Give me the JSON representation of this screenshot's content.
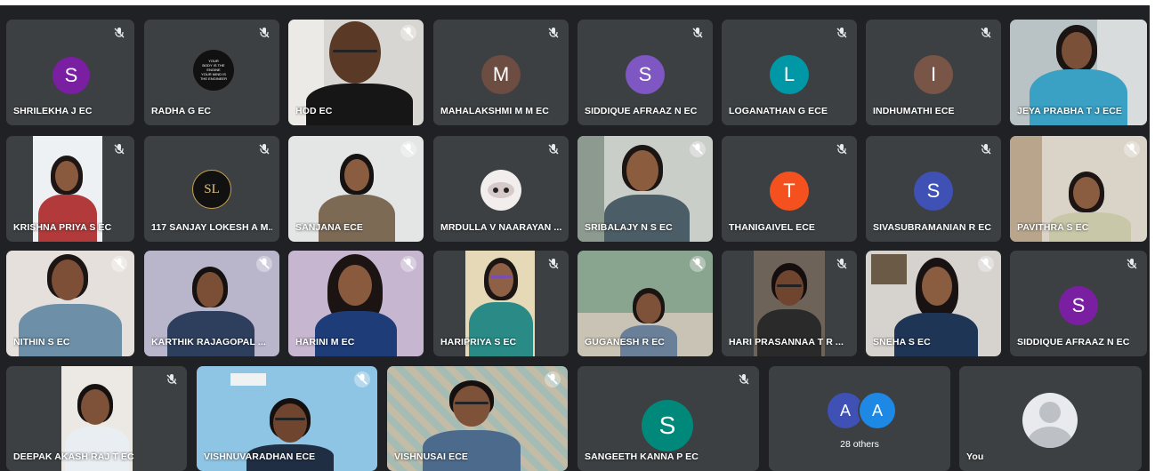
{
  "participants": [
    {
      "name": "SHRILEKHA J EC",
      "initial": "S",
      "avatar_color": "#7b1fa2"
    },
    {
      "name": "RADHA G EC",
      "logo_lines": [
        "YOUR",
        "BODY IS THE",
        "ENGINE",
        "YOUR MIND IS",
        "THE ENGINEER"
      ]
    },
    {
      "name": "HOD EC"
    },
    {
      "name": "MAHALAKSHMI M M EC",
      "initial": "M",
      "avatar_color": "#6d4c41"
    },
    {
      "name": "SIDDIQUE AFRAAZ N EC",
      "initial": "S",
      "avatar_color": "#7e57c2"
    },
    {
      "name": "LOGANATHAN G ECE",
      "initial": "L",
      "avatar_color": "#0097a7"
    },
    {
      "name": "INDHUMATHI ECE",
      "initial": "I",
      "avatar_color": "#795548"
    },
    {
      "name": "JEYA PRABHA T J ECE"
    },
    {
      "name": "KRISHNA PRIYA S EC"
    },
    {
      "name": "117 SANJAY LOKESH A M...",
      "logo_text": "SL"
    },
    {
      "name": "SANJANA ECE"
    },
    {
      "name": "MRDULLA V NAARAYAN ..."
    },
    {
      "name": "SRIBALAJY N S EC"
    },
    {
      "name": "THANIGAIVEL ECE",
      "initial": "T",
      "avatar_color": "#f4511e"
    },
    {
      "name": "SIVASUBRAMANIAN R EC",
      "initial": "S",
      "avatar_color": "#3f51b5"
    },
    {
      "name": "PAVITHRA S EC"
    },
    {
      "name": "NITHIN S EC"
    },
    {
      "name": "KARTHIK RAJAGOPAL ..."
    },
    {
      "name": "HARINI M EC"
    },
    {
      "name": "HARIPRIYA S EC"
    },
    {
      "name": "GUGANESH R EC"
    },
    {
      "name": "HARI PRASANNAA T R ..."
    },
    {
      "name": "SNEHA S EC"
    },
    {
      "name": "SIDDIQUE AFRAAZ N EC",
      "initial": "S",
      "avatar_color": "#7b1fa2"
    },
    {
      "name": "DEEPAK AKASH RAJ T EC"
    },
    {
      "name": "VISHNUVARADHAN ECE"
    },
    {
      "name": "VISHNUSAI ECE"
    },
    {
      "name": "SANGEETH KANNA P EC",
      "initial": "S",
      "avatar_color": "#00897b"
    }
  ],
  "others": {
    "label": "28 others",
    "initials": [
      "A",
      "A"
    ],
    "colors": [
      "#3f51b5",
      "#1e88e5"
    ]
  },
  "self": {
    "name": "You"
  },
  "icons": {
    "muted": "mic-off-icon"
  },
  "colors": {
    "tile": "#3c4043",
    "background": "#202124",
    "label": "#ffffff"
  }
}
